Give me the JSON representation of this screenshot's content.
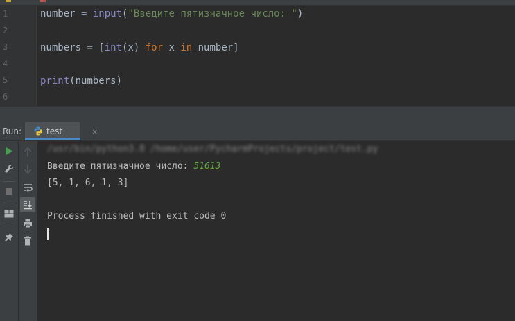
{
  "editor": {
    "line_numbers": [
      "1",
      "2",
      "3",
      "4",
      "5",
      "6"
    ],
    "lines": {
      "l1": {
        "var": "number",
        "op": " = ",
        "func": "input",
        "open": "(",
        "str": "\"Введите пятизначное число: \"",
        "close": ")"
      },
      "l3": {
        "var": "numbers",
        "op": " = [",
        "func": "int",
        "mid": "(x) ",
        "kw_for": "for",
        "x": " x ",
        "kw_in": "in",
        "rest": " number]"
      },
      "l5": {
        "func": "print",
        "rest": "(numbers)"
      }
    }
  },
  "run": {
    "label": "Run:",
    "tab": {
      "label": "test",
      "close": "×",
      "icon": "python-icon"
    }
  },
  "toolbar": {
    "left": [
      "run-icon",
      "wrench-icon",
      "stop-icon",
      "layout-icon",
      "pin-icon"
    ],
    "right": [
      "arrow-up-icon",
      "arrow-down-icon",
      "soft-wrap-icon",
      "scroll-to-end-icon",
      "print-icon",
      "trash-icon"
    ]
  },
  "console": {
    "command": "/usr/bin/python3.8 /home/user/PycharmProjects/project/test.py",
    "prompt": "Введите пятизначное число: ",
    "user_input": "51613",
    "output": "[5, 1, 6, 1, 3]",
    "exit_message": "Process finished with exit code 0"
  },
  "colors": {
    "background": "#2b2b2b",
    "panel": "#3c3f41",
    "string": "#6a8759",
    "keyword": "#cc7832",
    "builtin": "#8888c6",
    "user_input": "#62a83c",
    "run_green": "#499c54",
    "tab_underline": "#4a88c7"
  }
}
